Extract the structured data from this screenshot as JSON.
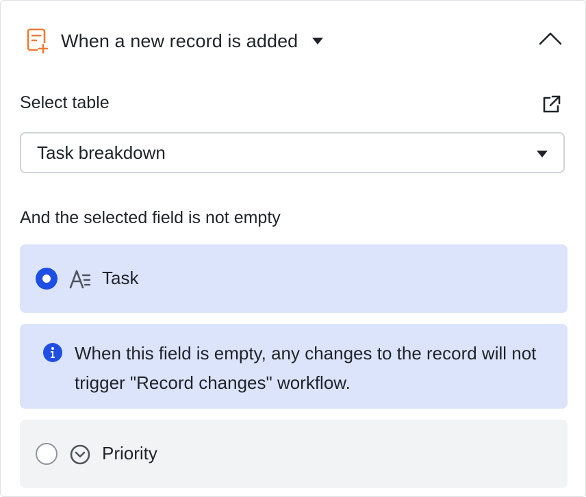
{
  "trigger": {
    "title": "When a new record is added",
    "icon": "record-add-icon",
    "accent_color": "#ee7a34"
  },
  "table_section": {
    "label": "Select table",
    "selected_table": "Task breakdown"
  },
  "field_section": {
    "label": "And the selected field is not empty",
    "options": [
      {
        "label": "Task",
        "icon": "text-field-icon",
        "selected": true
      },
      {
        "label": "Priority",
        "icon": "single-select-field-icon",
        "selected": false
      }
    ],
    "notice": "When this field is empty, any changes to the record will not trigger \"Record changes\" workflow."
  },
  "colors": {
    "primary": "#1f4ee5",
    "selected_bg": "#dce4fc",
    "unselected_bg": "#f2f3f5"
  }
}
